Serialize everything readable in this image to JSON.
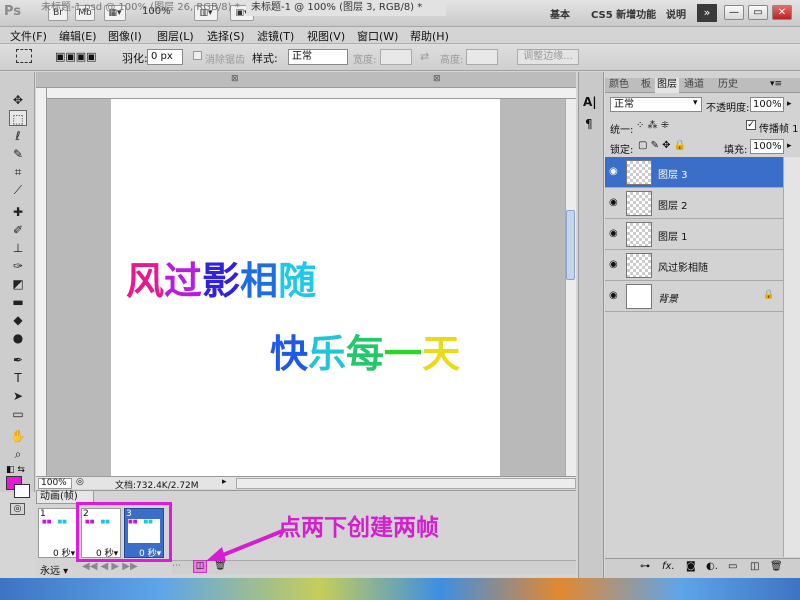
{
  "titlebar": {
    "logo": "Ps",
    "btn_br": "Br",
    "btn_mb": "Mb",
    "zoom": "100%",
    "workspace_essentials": "基本",
    "workspace_new": "CS5 新增功能",
    "help": "说明",
    "expand": "»",
    "minimize": "—",
    "restore": "▭",
    "close": "✕"
  },
  "menu": [
    "文件(F)",
    "编辑(E)",
    "图像(I)",
    "图层(L)",
    "选择(S)",
    "滤镜(T)",
    "视图(V)",
    "窗口(W)",
    "帮助(H)"
  ],
  "options": {
    "feather_label": "羽化:",
    "feather_value": "0 px",
    "antialias_label": "消除锯齿",
    "style_label": "样式:",
    "style_value": "正常",
    "width_label": "宽度:",
    "height_label": "高度:",
    "refine_edge": "调整边缘..."
  },
  "doc_tabs": [
    "未标题-1.psd @ 100% (图层 26, RGB/8) *",
    "未标题-1 @ 100% (图层 3, RGB/8) *"
  ],
  "canvas": {
    "line1": [
      "风",
      "过",
      "影",
      "相",
      "随"
    ],
    "line2": [
      "快",
      "乐",
      "每",
      "一",
      "天"
    ]
  },
  "status": {
    "zoom": "100%",
    "doc_info": "文档:732.4K/2.72M"
  },
  "animation": {
    "tab_label": "动画(帧)",
    "frames": [
      {
        "num": "1",
        "delay": "0 秒▾"
      },
      {
        "num": "2",
        "delay": "0 秒▾"
      },
      {
        "num": "3",
        "delay": "0 秒▾"
      }
    ],
    "loop": "永远 ▾",
    "annotation": "点两下创建两帧"
  },
  "layers_panel": {
    "tabs": [
      "颜",
      "色",
      "板",
      "图层",
      "通",
      "道",
      "历",
      "史"
    ],
    "blend_mode": "正常",
    "opacity_label": "不透明度:",
    "opacity_value": "100%",
    "unify_label": "统一:",
    "propagate_label": "传播帧 1",
    "lock_label": "锁定:",
    "fill_label": "填充:",
    "fill_value": "100%",
    "layers": [
      {
        "name": "图层 3",
        "selected": true
      },
      {
        "name": "图层 2",
        "selected": false
      },
      {
        "name": "图层 1",
        "selected": false
      },
      {
        "name": "风过影相随",
        "selected": false
      },
      {
        "name": "背景",
        "selected": false
      }
    ]
  },
  "colors": {
    "foreground": "#e619d8",
    "background": "#ffffff",
    "selection": "#3b6ec9",
    "annotation": "#d41fd0"
  }
}
